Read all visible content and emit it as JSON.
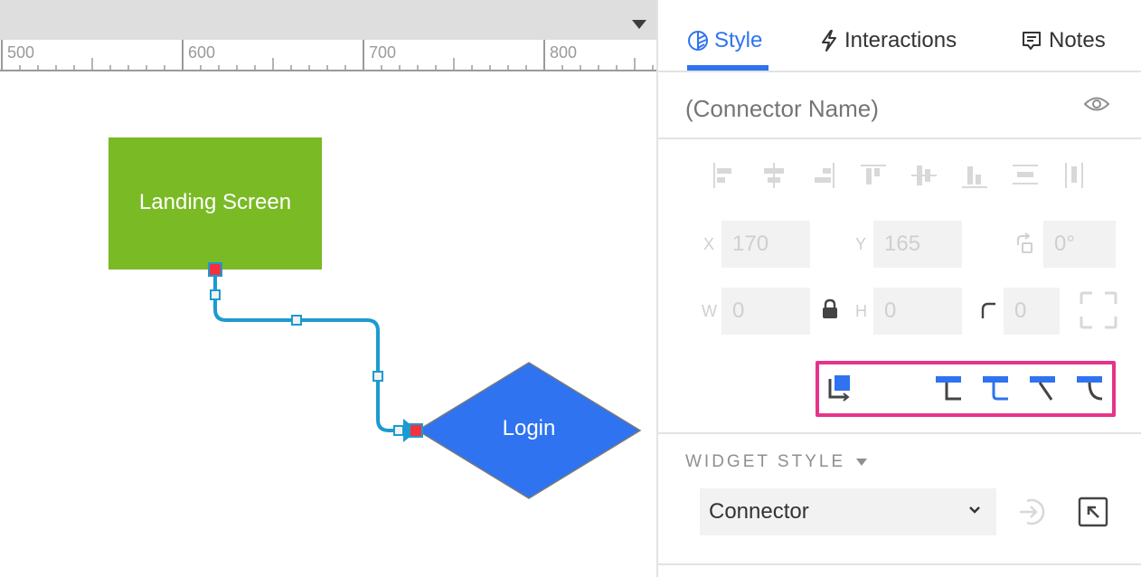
{
  "canvas": {
    "ruler_labels": [
      "500",
      "600",
      "700",
      "800"
    ],
    "shapes": [
      {
        "id": "landing",
        "label": "Landing Screen",
        "kind": "rectangle",
        "fill": "#7aba25"
      },
      {
        "id": "login",
        "label": "Login",
        "kind": "diamond",
        "fill": "#2f73f0",
        "stroke": "#7a7a7a"
      }
    ],
    "connector": {
      "color": "#1b9bd1",
      "endpoint_color": "#f5303e",
      "handle_fill": "#f2f2f2"
    }
  },
  "panel": {
    "tabs": [
      {
        "label": "Style",
        "icon": "leaf-icon",
        "active": true
      },
      {
        "label": "Interactions",
        "icon": "lightning-icon",
        "active": false
      },
      {
        "label": "Notes",
        "icon": "notes-icon",
        "active": false
      }
    ],
    "name_placeholder": "(Connector Name)",
    "align_buttons": [
      "align-left",
      "align-center",
      "align-right",
      "align-top",
      "align-middle",
      "align-bottom",
      "distribute-horizontal",
      "distribute-vertical"
    ],
    "fields": {
      "x_label": "X",
      "x_value": "170",
      "y_label": "Y",
      "y_value": "165",
      "rotation_value": "0°",
      "w_label": "W",
      "w_value": "0",
      "h_label": "H",
      "h_value": "0",
      "corner_value": "0"
    },
    "connector_styles": [
      "arrow-style",
      "elbow-connector",
      "rounded-elbow-connector",
      "straight-connector",
      "curved-connector"
    ],
    "widget_style": {
      "title": "WIDGET STYLE",
      "selected": "Connector"
    },
    "accent": "#2f73f0",
    "highlight": "#e7338a"
  }
}
